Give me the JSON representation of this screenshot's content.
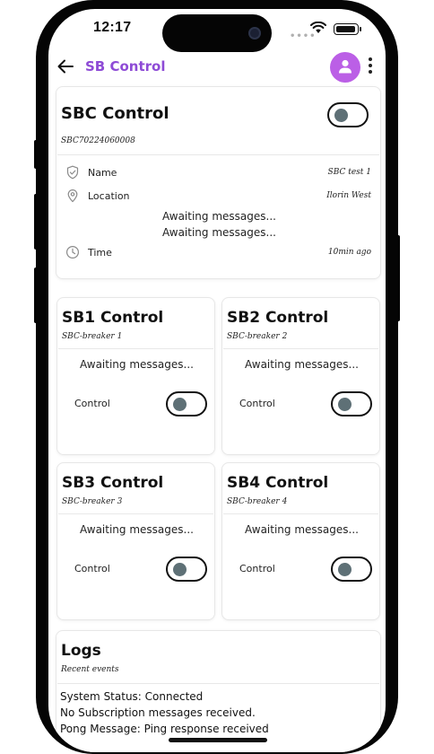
{
  "status_bar": {
    "time": "12:17",
    "signal_dots": "••••"
  },
  "app_bar": {
    "title": "SB Control",
    "back_icon": "arrow-left-icon",
    "avatar_icon": "person-icon",
    "menu_icon": "more-vertical-icon"
  },
  "colors": {
    "accent": "#8e4bd6",
    "avatar_bg": "#bb5fe6",
    "toggle_knob": "#5e7076"
  },
  "main_card": {
    "title": "SBC Control",
    "serial": "SBC70224060008",
    "toggle_on": false,
    "rows": [
      {
        "icon": "shield-check-icon",
        "label": "Name",
        "value": "SBC test 1"
      },
      {
        "icon": "location-pin-icon",
        "label": "Location",
        "value": "Ilorin West"
      },
      {
        "icon": "clock-icon",
        "label": "Time",
        "value": "10min ago"
      }
    ],
    "messages": [
      "Awaiting messages...",
      "Awaiting messages..."
    ]
  },
  "breakers": [
    {
      "title": "SB1 Control",
      "subtitle": "SBC-breaker 1",
      "message": "Awaiting messages...",
      "control_label": "Control",
      "toggle_on": false
    },
    {
      "title": "SB2 Control",
      "subtitle": "SBC-breaker 2",
      "message": "Awaiting messages...",
      "control_label": "Control",
      "toggle_on": false
    },
    {
      "title": "SB3 Control",
      "subtitle": "SBC-breaker 3",
      "message": "Awaiting messages...",
      "control_label": "Control",
      "toggle_on": false
    },
    {
      "title": "SB4 Control",
      "subtitle": "SBC-breaker 4",
      "message": "Awaiting messages...",
      "control_label": "Control",
      "toggle_on": false
    }
  ],
  "logs": {
    "title": "Logs",
    "subtitle": "Recent events",
    "lines": [
      "System Status: Connected",
      "No Subscription messages received.",
      "Pong Message: Ping response received"
    ]
  }
}
